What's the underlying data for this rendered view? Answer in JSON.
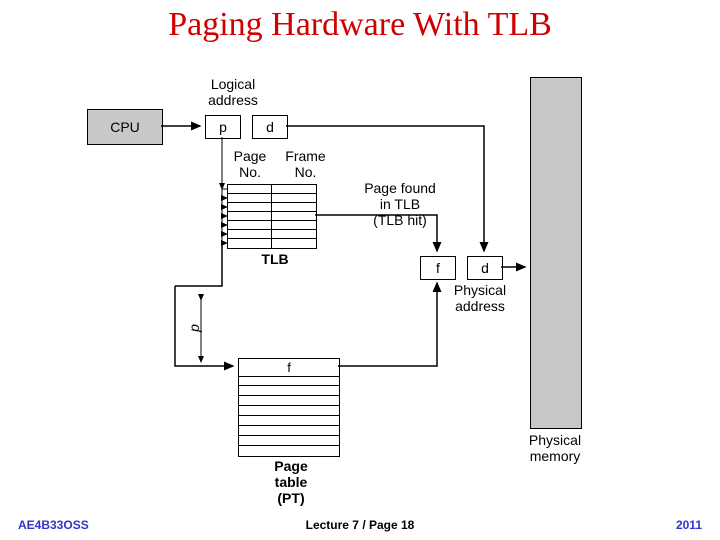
{
  "title": "Paging Hardware With TLB",
  "footer": {
    "left": "AE4B33OSS",
    "center": "Lecture 7 / Page 18",
    "right": "2011"
  },
  "cpu": "CPU",
  "logical_addr": "Logical\naddress",
  "p": "p",
  "d": "d",
  "page_no": "Page\nNo.",
  "frame_no": "Frame\nNo.",
  "tlb": "TLB",
  "page_found": "Page found\nin TLB\n(TLB hit)",
  "f": "f",
  "d2": "d",
  "phys_addr": "Physical\naddress",
  "p_idx": "p",
  "f_cell": "f",
  "page_table": "Page\ntable\n(PT)",
  "phys_mem": "Physical\nmemory"
}
